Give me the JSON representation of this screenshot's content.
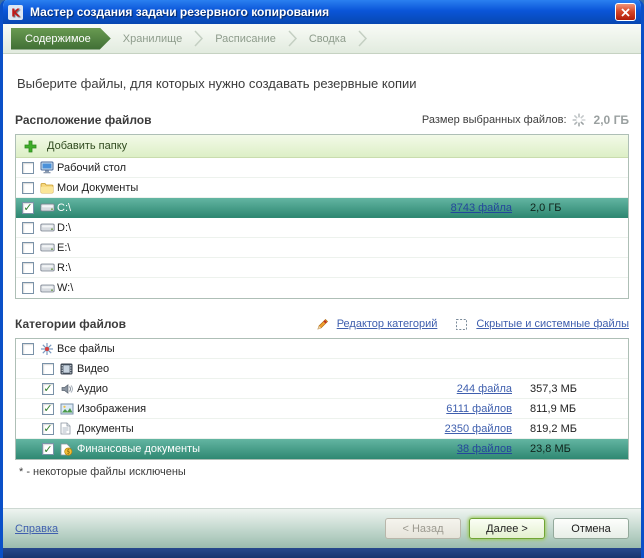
{
  "window": {
    "title": "Мастер создания задачи резервного копирования"
  },
  "steps": [
    {
      "label": "Содержимое",
      "active": true
    },
    {
      "label": "Хранилище",
      "active": false
    },
    {
      "label": "Расписание",
      "active": false
    },
    {
      "label": "Сводка",
      "active": false
    }
  ],
  "heading": "Выберите файлы, для которых нужно создавать резервные копии",
  "locations": {
    "title": "Расположение файлов",
    "size_label": "Размер выбранных файлов:",
    "size_value": "2,0 ГБ",
    "add_folder_label": "Добавить папку",
    "rows": [
      {
        "label": "Рабочий стол",
        "icon": "desktop",
        "checked": false
      },
      {
        "label": "Мои Документы",
        "icon": "folder",
        "checked": false
      },
      {
        "label": "C:\\",
        "icon": "drive",
        "checked": true,
        "selected": true,
        "count": "8743 файла",
        "size": "2,0 ГБ"
      },
      {
        "label": "D:\\",
        "icon": "drive",
        "checked": false
      },
      {
        "label": "E:\\",
        "icon": "drive",
        "checked": false
      },
      {
        "label": "R:\\",
        "icon": "drive",
        "checked": false
      },
      {
        "label": "W:\\",
        "icon": "drive",
        "checked": false
      }
    ]
  },
  "categories": {
    "title": "Категории файлов",
    "editor_link": "Редактор категорий",
    "hidden_link": "Скрытые и системные файлы",
    "rows": [
      {
        "label": "Все файлы",
        "icon": "all",
        "checked": false,
        "indent": 0
      },
      {
        "label": "Видео",
        "icon": "video",
        "checked": false,
        "indent": 1
      },
      {
        "label": "Аудио",
        "icon": "audio",
        "checked": true,
        "indent": 1,
        "count": "244 файла",
        "size": "357,3 МБ"
      },
      {
        "label": "Изображения",
        "icon": "images",
        "checked": true,
        "indent": 1,
        "count": "6111 файлов",
        "size": "811,9 МБ"
      },
      {
        "label": "Документы",
        "icon": "docs",
        "checked": true,
        "indent": 1,
        "count": "2350 файлов",
        "size": "819,2 МБ"
      },
      {
        "label": "Финансовые документы",
        "icon": "finance",
        "checked": true,
        "indent": 1,
        "selected": true,
        "count": "38 файлов",
        "size": "23,8 МБ"
      }
    ],
    "footnote": "* - некоторые файлы исключены"
  },
  "footer": {
    "help": "Справка",
    "back": "< Назад",
    "next": "Далее >",
    "cancel": "Отмена"
  },
  "colors": {
    "accent_green": "#3f6e35",
    "selection_teal": "#2f8872",
    "link_blue": "#3f5fae",
    "titlebar_blue": "#0a55d8"
  }
}
